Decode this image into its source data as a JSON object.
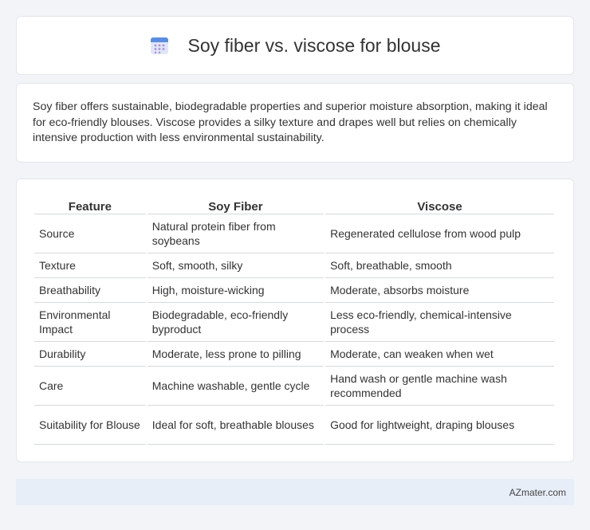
{
  "header": {
    "title": "Soy fiber vs. viscose for blouse",
    "icon": "calendar-icon"
  },
  "summary": {
    "text": "Soy fiber offers sustainable, biodegradable properties and superior moisture absorption, making it ideal for eco-friendly blouses. Viscose provides a silky texture and drapes well but relies on chemically intensive production with less environmental sustainability."
  },
  "table": {
    "headers": [
      "Feature",
      "Soy Fiber",
      "Viscose"
    ],
    "rows": [
      [
        "Source",
        "Natural protein fiber from soybeans",
        "Regenerated cellulose from wood pulp"
      ],
      [
        "Texture",
        "Soft, smooth, silky",
        "Soft, breathable, smooth"
      ],
      [
        "Breathability",
        "High, moisture-wicking",
        "Moderate, absorbs moisture"
      ],
      [
        "Environmental Impact",
        "Biodegradable, eco-friendly byproduct",
        "Less eco-friendly, chemical-intensive process"
      ],
      [
        "Durability",
        "Moderate, less prone to pilling",
        "Moderate, can weaken when wet"
      ],
      [
        "Care",
        "Machine washable, gentle cycle",
        "Hand wash or gentle machine wash recommended"
      ],
      [
        "Suitability for Blouse",
        "Ideal for soft, breathable blouses",
        "Good for lightweight, draping blouses"
      ]
    ]
  },
  "footer": {
    "brand": "AZmater.com"
  }
}
